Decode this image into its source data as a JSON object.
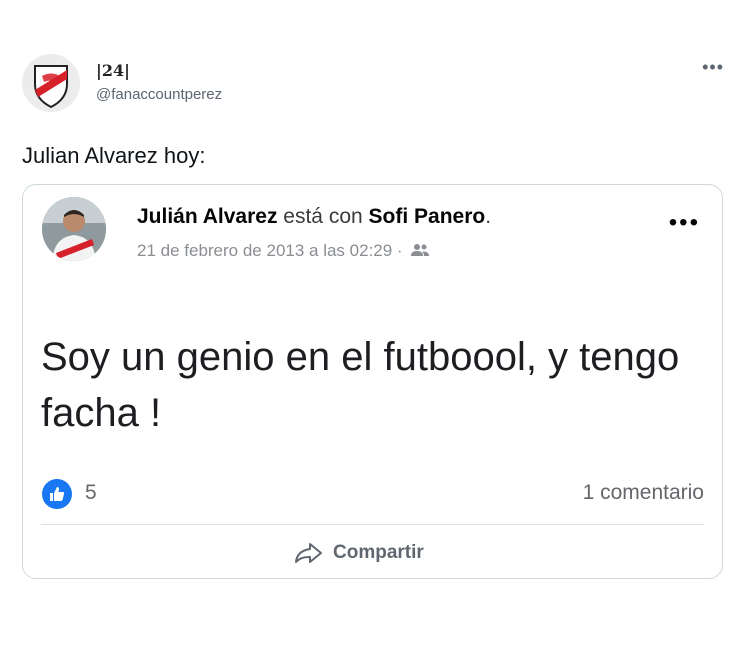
{
  "tweet": {
    "display_name": "|24|",
    "handle": "@fanaccountperez",
    "more_icon": "more-horizontal-icon",
    "text": "Julian Alvarez hoy:"
  },
  "embedded_post": {
    "author": "Julián Alvarez",
    "connector": "está con",
    "tagged": "Sofi Panero",
    "period": ".",
    "date": "21 de febrero de 2013 a las 02:29 ·",
    "audience_icon": "friends-audience-icon",
    "text": "Soy un genio en el futboool, y tengo facha !",
    "like_count": "5",
    "comments": "1 comentario",
    "share_label": "Compartir",
    "colors": {
      "like_blue": "#1877f2",
      "river_red": "#d6202a"
    }
  }
}
